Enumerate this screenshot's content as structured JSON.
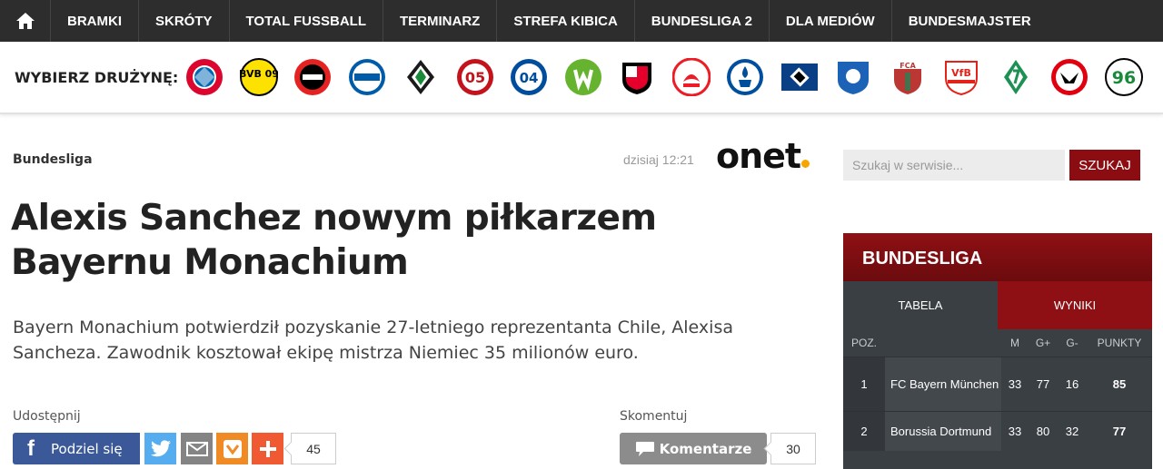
{
  "nav": {
    "items": [
      "BRAMKI",
      "SKRÓTY",
      "TOTAL FUSSBALL",
      "TERMINARZ",
      "STREFA KIBICA",
      "BUNDESLIGA 2",
      "DLA MEDIÓW",
      "BUNDESMAJSTER"
    ]
  },
  "teams": {
    "label": "WYBIERZ DRUŻYNĘ:",
    "logos": [
      "bayern-logo",
      "dortmund-logo",
      "leverkusen-logo",
      "hertha-logo",
      "gladbach-logo",
      "mainz-logo",
      "schalke-logo",
      "wolfsburg-logo",
      "ingolstadt-logo",
      "koln-logo",
      "darmstadt-logo",
      "hamburg-logo",
      "hoffenheim-logo",
      "augsburg-logo",
      "stuttgart-logo",
      "bremen-logo",
      "frankfurt-logo",
      "hannover-logo"
    ],
    "logo_texts": {
      "dortmund": "BVB 09",
      "augsburg": "FCA",
      "stuttgart": "VfB",
      "schalke": "04",
      "mainz": "05",
      "hannover": "96"
    }
  },
  "article": {
    "category": "Bundesliga",
    "timestamp": "dzisiaj 12:21",
    "source": "onet",
    "headline_line1": "Alexis Sanchez nowym piłkarzem",
    "headline_line2": "Bayernu Monachium",
    "lead": "Bayern Monachium potwierdził pozyskanie 27-letniego reprezentanta Chile, Alexisa Sancheza. Zawodnik kosztował ekipę mistrza Niemiec 35 milionów euro."
  },
  "share": {
    "label": "Udostępnij",
    "facebook_label": "Podziel się",
    "count": "45"
  },
  "comments": {
    "label": "Skomentuj",
    "button_label": "Komentarze",
    "count": "30"
  },
  "search": {
    "placeholder": "Szukaj w serwisie...",
    "button_label": "SZUKAJ"
  },
  "widget": {
    "title": "BUNDESLIGA",
    "tabs": [
      "TABELA",
      "WYNIKI"
    ],
    "columns": {
      "poz": "POZ.",
      "m": "M",
      "gplus": "G+",
      "gminus": "G-",
      "points": "PUNKTY"
    },
    "rows": [
      {
        "poz": "1",
        "team": "FC Bayern München",
        "m": "33",
        "gplus": "77",
        "gminus": "16",
        "points": "85"
      },
      {
        "poz": "2",
        "team": "Borussia Dortmund",
        "m": "33",
        "gplus": "80",
        "gminus": "32",
        "points": "77"
      }
    ]
  },
  "colors": {
    "nav_bg": "#2d2d2d",
    "accent_red": "#8b0d12",
    "facebook": "#3b5998",
    "twitter": "#55acee",
    "email": "#848484",
    "wykop": "#f08a24",
    "plus": "#ef5a33",
    "onet_dot": "#f7a600"
  }
}
